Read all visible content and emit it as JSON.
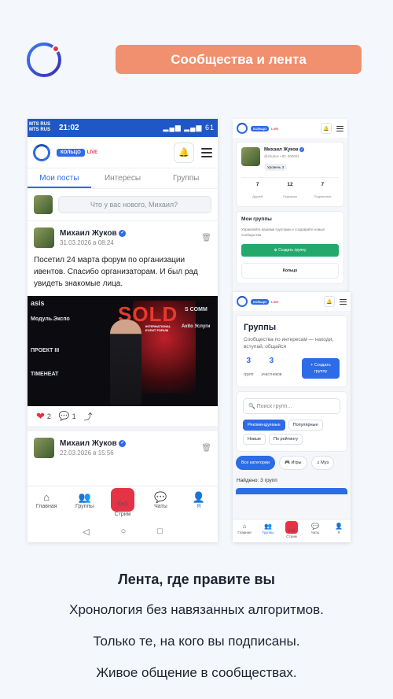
{
  "header": {
    "badge": "Сообщества и лента"
  },
  "captions": {
    "title": "Лента, где правите вы",
    "lines": [
      "Хронология без навязанных алгоритмов.",
      "Только те, на кого вы подписаны.",
      "Живое общение в сообществах."
    ]
  },
  "phone1": {
    "status": {
      "carrier1": "MTS RUS",
      "carrier2": "MTS RUS",
      "time": "21:02",
      "battery": "61"
    },
    "app": {
      "brand": "КОЛЬЦО",
      "live": "LIVE"
    },
    "tabs": [
      "Мои посты",
      "Интересы",
      "Группы"
    ],
    "compose_placeholder": "Что у вас нового, Михаил?",
    "posts": [
      {
        "author": "Михаил Жуков",
        "date": "31.03.2026 в 08:24",
        "text": "Посетил 24 марта форум по организации ивентов. Спасибо организаторам. И был рад увидеть знакомые лица.",
        "likes": "2",
        "comments": "1"
      },
      {
        "author": "Михаил Жуков",
        "date": "22.03.2026 в 15:56"
      }
    ],
    "photo_texts": {
      "sold": "SOLD",
      "asis": "asis",
      "expo": "Модуль.Экспо",
      "proekt": "ПРОЕКТ III",
      "timeheat": "TIMEHEAT",
      "scomm": "S COMM",
      "avito": "Avito Услуги",
      "forum": "INTERNATIONAL EVENT FORUM"
    },
    "nav": [
      "Главная",
      "Группы",
      "Стрим",
      "Чаты",
      "Я"
    ]
  },
  "phone2": {
    "brand": "КОЛЬЦО",
    "live": "LIVE",
    "profile": {
      "name": "Михаил Жуков",
      "handle": "@zhukov • ID: 000001",
      "level": "Уровень 3"
    },
    "stats": [
      {
        "value": "7",
        "label": "Друзей"
      },
      {
        "value": "12",
        "label": "Подписки"
      },
      {
        "value": "7",
        "label": "Подписчики"
      }
    ],
    "groups_title": "Мои группы",
    "groups_sub": "Управляйте вашими группами и создавайте новые сообщества",
    "create_button": "Создать группу",
    "next_card": "Кольцо"
  },
  "phone3": {
    "brand": "КОЛЬЦО",
    "live": "LIVE",
    "title": "Группы",
    "subtitle": "Сообщества по интересам — находи, вступай, общайся",
    "count_groups": "3",
    "count_groups_label": "групп",
    "count_members": "3",
    "count_members_label": "участников",
    "create_button": "Создать группу",
    "search_placeholder": "Поиск групп...",
    "filters": [
      "Рекомендуемые",
      "Популярные",
      "Новые",
      "По рейтингу"
    ],
    "categories": [
      "Все категории",
      "Игры",
      "Муз"
    ],
    "found": "Найдено: 3 групп",
    "nav": [
      "Главная",
      "Группы",
      "Стрим",
      "Чаты",
      "Я"
    ]
  },
  "colors": {
    "accent": "#2e6be6",
    "badge": "#f0906e",
    "live": "#e53245",
    "green": "#24a96d"
  }
}
